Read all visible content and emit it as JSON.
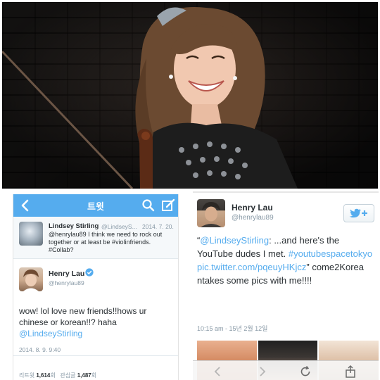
{
  "left_tweet": {
    "header_title": "트윗",
    "reply": {
      "name": "Lindsey Stirling",
      "handle": "@LindseyS...",
      "date": "2014. 7. 20.",
      "text": "@henrylau89 I think we need to rock out together or at least be #violinfriends. #Collab?"
    },
    "main": {
      "name": "Henry Lau",
      "handle": "@henrylau89",
      "text": "wow! lol love new friends!!hows ur chinese or korean!!? haha",
      "mention": "@LindseyStirling",
      "date": "2014. 8. 9. 9:40"
    },
    "stats": {
      "retweets_label": "리트윗",
      "retweets": "1,614",
      "retweets_unit": "회",
      "favorites_label": "관심글",
      "favorites": "1,487",
      "favorites_unit": "회"
    }
  },
  "right_tweet": {
    "name": "Henry Lau",
    "handle": "@henrylau89",
    "quote_open": "“",
    "mention": "@LindseyStirling",
    "text_part1": ": ...and here's the YouTube dudes I met.",
    "hashtag": "#youtubespacetokyo",
    "link": "pic.twitter.com/pqeuyHKjcz",
    "quote_close": "”",
    "text_part2": "come2Korea ntakes some pics with me!!!!",
    "meta": "10:15 am - 15년 2월 12일"
  },
  "colors": {
    "twitter_blue": "#55acee",
    "text_dark": "#292f33",
    "text_gray": "#8899a6"
  },
  "icons": [
    "chevron-left-icon",
    "search-icon",
    "compose-icon",
    "verified-icon",
    "follow-icon",
    "back-icon",
    "forward-icon",
    "reload-icon",
    "share-icon"
  ]
}
